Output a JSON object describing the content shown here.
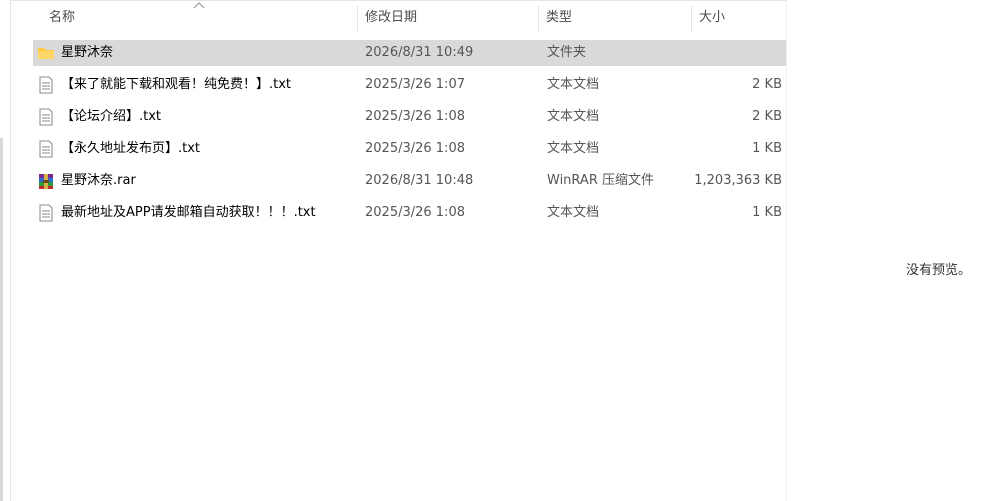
{
  "columns": {
    "name": "名称",
    "date": "修改日期",
    "type": "类型",
    "size": "大小"
  },
  "rows": [
    {
      "name": "星野沐奈",
      "date": "2026/8/31 10:49",
      "type": "文件夹",
      "size": "",
      "icon": "folder-icon",
      "selected": true
    },
    {
      "name": "【来了就能下载和观看！纯免费！】.txt",
      "date": "2025/3/26 1:07",
      "type": "文本文档",
      "size": "2 KB",
      "icon": "text-file-icon"
    },
    {
      "name": "【论坛介绍】.txt",
      "date": "2025/3/26 1:08",
      "type": "文本文档",
      "size": "2 KB",
      "icon": "text-file-icon"
    },
    {
      "name": "【永久地址发布页】.txt",
      "date": "2025/3/26 1:08",
      "type": "文本文档",
      "size": "1 KB",
      "icon": "text-file-icon"
    },
    {
      "name": "星野沐奈.rar",
      "date": "2026/8/31 10:48",
      "type": "WinRAR 压缩文件",
      "size": "1,203,363 KB",
      "icon": "winrar-archive-icon"
    },
    {
      "name": "最新地址及APP请发邮箱自动获取！！！.txt",
      "date": "2025/3/26 1:08",
      "type": "文本文档",
      "size": "1 KB",
      "icon": "text-file-icon"
    }
  ],
  "preview": {
    "message": "没有预览。"
  },
  "colors": {
    "selected_row": "#d9d9d9",
    "folder": "#ffc83d",
    "header_text": "#4c4c4c"
  }
}
